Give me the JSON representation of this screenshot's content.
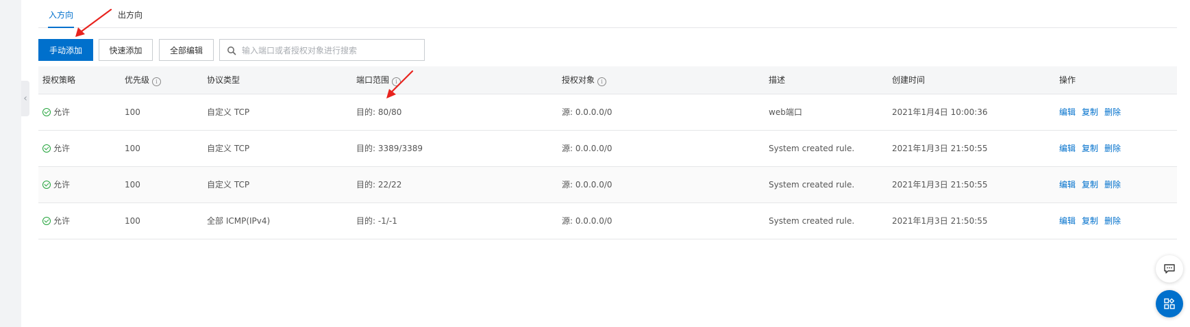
{
  "tabs": [
    {
      "label": "入方向",
      "active": true
    },
    {
      "label": "出方向",
      "active": false
    }
  ],
  "toolbar": {
    "manual_add": "手动添加",
    "quick_add": "快速添加",
    "edit_all": "全部编辑",
    "search_placeholder": "输入端口或者授权对象进行搜索"
  },
  "table": {
    "headers": {
      "policy": "授权策略",
      "priority": "优先级",
      "protocol": "协议类型",
      "port_range": "端口范围",
      "auth_object": "授权对象",
      "description": "描述",
      "created": "创建时间",
      "actions": "操作"
    },
    "rows": [
      {
        "policy": "允许",
        "priority": "100",
        "protocol": "自定义 TCP",
        "port": "目的: 80/80",
        "source": "源: 0.0.0.0/0",
        "desc": "web端口",
        "created": "2021年1月4日 10:00:36"
      },
      {
        "policy": "允许",
        "priority": "100",
        "protocol": "自定义 TCP",
        "port": "目的: 3389/3389",
        "source": "源: 0.0.0.0/0",
        "desc": "System created rule.",
        "created": "2021年1月3日 21:50:55"
      },
      {
        "policy": "允许",
        "priority": "100",
        "protocol": "自定义 TCP",
        "port": "目的: 22/22",
        "source": "源: 0.0.0.0/0",
        "desc": "System created rule.",
        "created": "2021年1月3日 21:50:55"
      },
      {
        "policy": "允许",
        "priority": "100",
        "protocol": "全部 ICMP(IPv4)",
        "port": "目的: -1/-1",
        "source": "源: 0.0.0.0/0",
        "desc": "System created rule.",
        "created": "2021年1月3日 21:50:55"
      }
    ],
    "actions": {
      "edit": "编辑",
      "copy": "复制",
      "delete": "删除"
    }
  },
  "colors": {
    "primary": "#0070cc",
    "allow": "#22a33a",
    "annotation_arrow": "#e8231e"
  },
  "icons": [
    "collapse-chevron-icon",
    "search-icon",
    "info-icon",
    "check-circle-icon",
    "chat-icon",
    "apps-icon"
  ]
}
